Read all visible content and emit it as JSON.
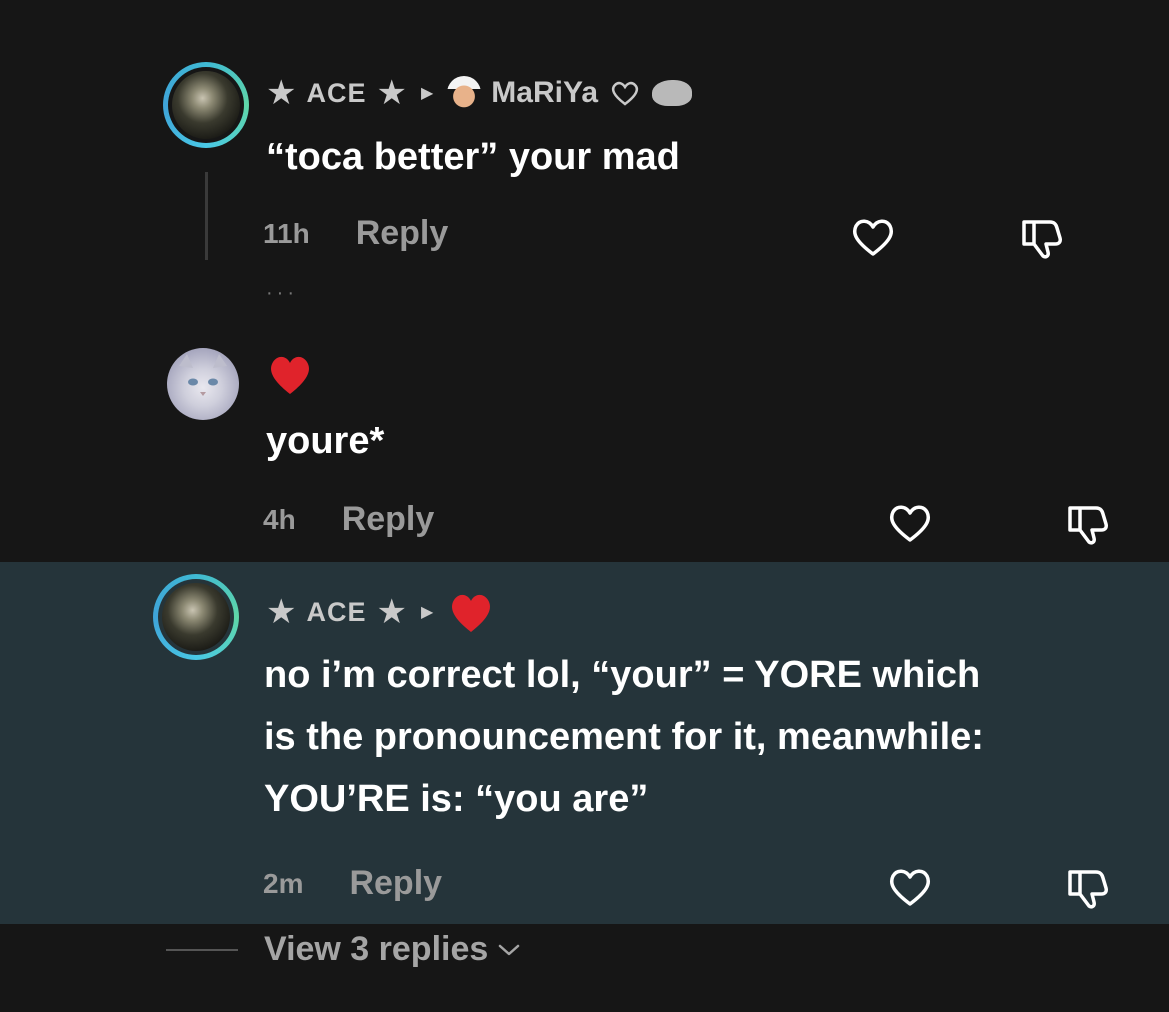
{
  "comments": [
    {
      "author": "ACE",
      "reply_to": "MaRiYa",
      "text": "“toca better” your mad",
      "time": "11h",
      "reply_label": "Reply"
    },
    {
      "text": "youre*",
      "time": "4h",
      "reply_label": "Reply"
    },
    {
      "author": "ACE",
      "text_lines": [
        "no i’m correct lol, “your” = YORE which",
        "is the pronouncement for it, meanwhile:",
        "YOU’RE is: “you are”"
      ],
      "time": "2m",
      "reply_label": "Reply"
    }
  ],
  "view_replies": "View 3 replies",
  "colors": {
    "background": "#161616",
    "highlight": "#25343a",
    "heart_red": "#e0232b",
    "ring": "#3fb9d4",
    "muted": "#9a9a9a"
  },
  "icons": [
    "star-icon",
    "caret-right-icon",
    "chef-emoji-icon",
    "rat-emoji-icon",
    "red-heart-icon",
    "like-heart-icon",
    "dislike-thumb-icon",
    "chevron-down-icon"
  ]
}
